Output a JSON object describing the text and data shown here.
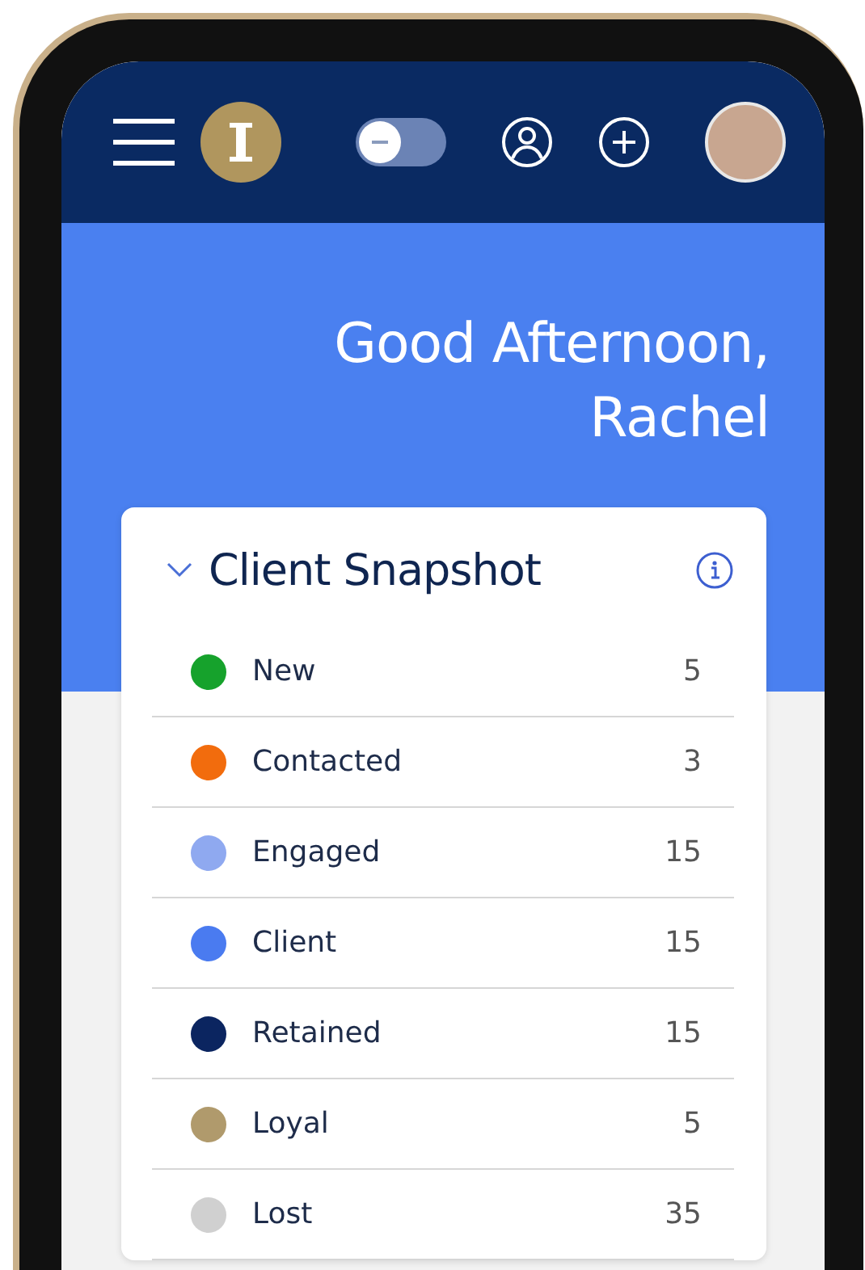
{
  "header": {
    "toggle": {
      "on": false
    }
  },
  "greeting": "Good Afternoon, Rachel",
  "snapshot": {
    "title": "Client Snapshot",
    "expanded": true,
    "rows": [
      {
        "label": "New",
        "count": "5",
        "color": "#16a22c"
      },
      {
        "label": "Contacted",
        "count": "3",
        "color": "#f26c0d"
      },
      {
        "label": "Engaged",
        "count": "15",
        "color": "#8fa9f0"
      },
      {
        "label": "Client",
        "count": "15",
        "color": "#4a7bf0"
      },
      {
        "label": "Retained",
        "count": "15",
        "color": "#0b2560"
      },
      {
        "label": "Loyal",
        "count": "5",
        "color": "#b09a6c"
      },
      {
        "label": "Lost",
        "count": "35",
        "color": "#d0d0d0"
      }
    ]
  }
}
